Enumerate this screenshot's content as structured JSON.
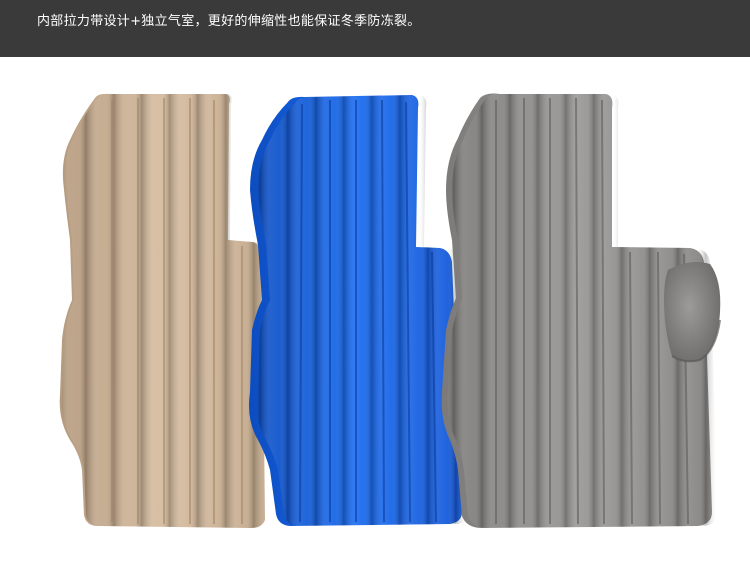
{
  "banner": {
    "text": "内部拉力带设计+独立气室，更好的伸缩性也能保证冬季防冻裂。"
  },
  "colors": {
    "banner_background": "#3a3a3a",
    "beige_mattress": "#c9ad90",
    "blue_mattress": "#1560e0",
    "gray_mattress": "#8d8b89"
  },
  "products": [
    {
      "name": "beige-mattress",
      "color": "#c9ad90"
    },
    {
      "name": "blue-mattress",
      "color": "#1560e0"
    },
    {
      "name": "gray-mattress",
      "color": "#8d8b89"
    }
  ]
}
